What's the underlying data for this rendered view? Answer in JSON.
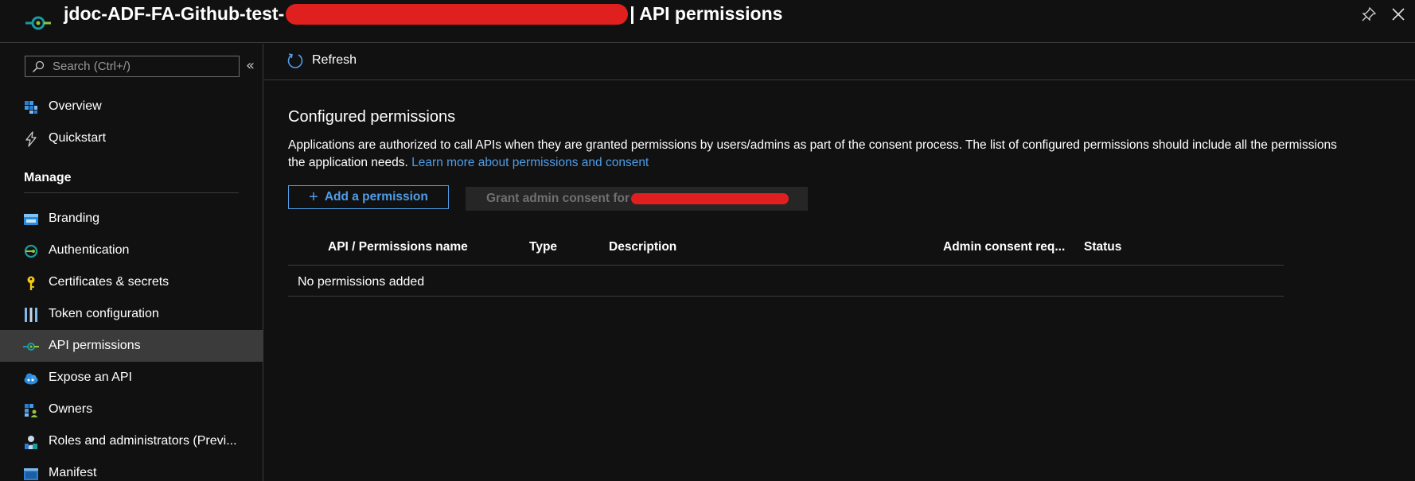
{
  "header": {
    "title_prefix": "jdoc-ADF-FA-Github-test-",
    "title_suffix": "| API permissions",
    "pin_icon": "pin-icon",
    "close_icon": "close-icon"
  },
  "sidebar": {
    "search_placeholder": "Search (Ctrl+/)",
    "collapse_glyph": "«",
    "items_top": [
      {
        "label": "Overview",
        "icon": "overview-icon"
      },
      {
        "label": "Quickstart",
        "icon": "quickstart-icon"
      }
    ],
    "manage_heading": "Manage",
    "items_manage": [
      {
        "label": "Branding",
        "icon": "branding-icon"
      },
      {
        "label": "Authentication",
        "icon": "authentication-icon"
      },
      {
        "label": "Certificates & secrets",
        "icon": "key-icon"
      },
      {
        "label": "Token configuration",
        "icon": "token-icon"
      },
      {
        "label": "API permissions",
        "icon": "api-permissions-icon",
        "active": true
      },
      {
        "label": "Expose an API",
        "icon": "cloud-icon"
      },
      {
        "label": "Owners",
        "icon": "owners-icon"
      },
      {
        "label": "Roles and administrators (Previ...",
        "icon": "roles-icon"
      },
      {
        "label": "Manifest",
        "icon": "manifest-icon"
      }
    ]
  },
  "toolbar": {
    "refresh_label": "Refresh"
  },
  "main": {
    "title": "Configured permissions",
    "description": "Applications are authorized to call APIs when they are granted permissions by users/admins as part of the consent process. The list of configured permissions should include all the permissions the application needs. ",
    "learn_more": "Learn more about permissions and consent",
    "add_permission_label": "Add a permission",
    "grant_consent_label": "Grant admin consent for",
    "table": {
      "columns": [
        "API / Permissions name",
        "Type",
        "Description",
        "Admin consent req...",
        "Status"
      ],
      "empty_text": "No permissions added"
    }
  },
  "colors": {
    "background": "#111111",
    "accent": "#4f9de8",
    "active_row": "#3b3b3b",
    "redaction": "#e0201e"
  }
}
